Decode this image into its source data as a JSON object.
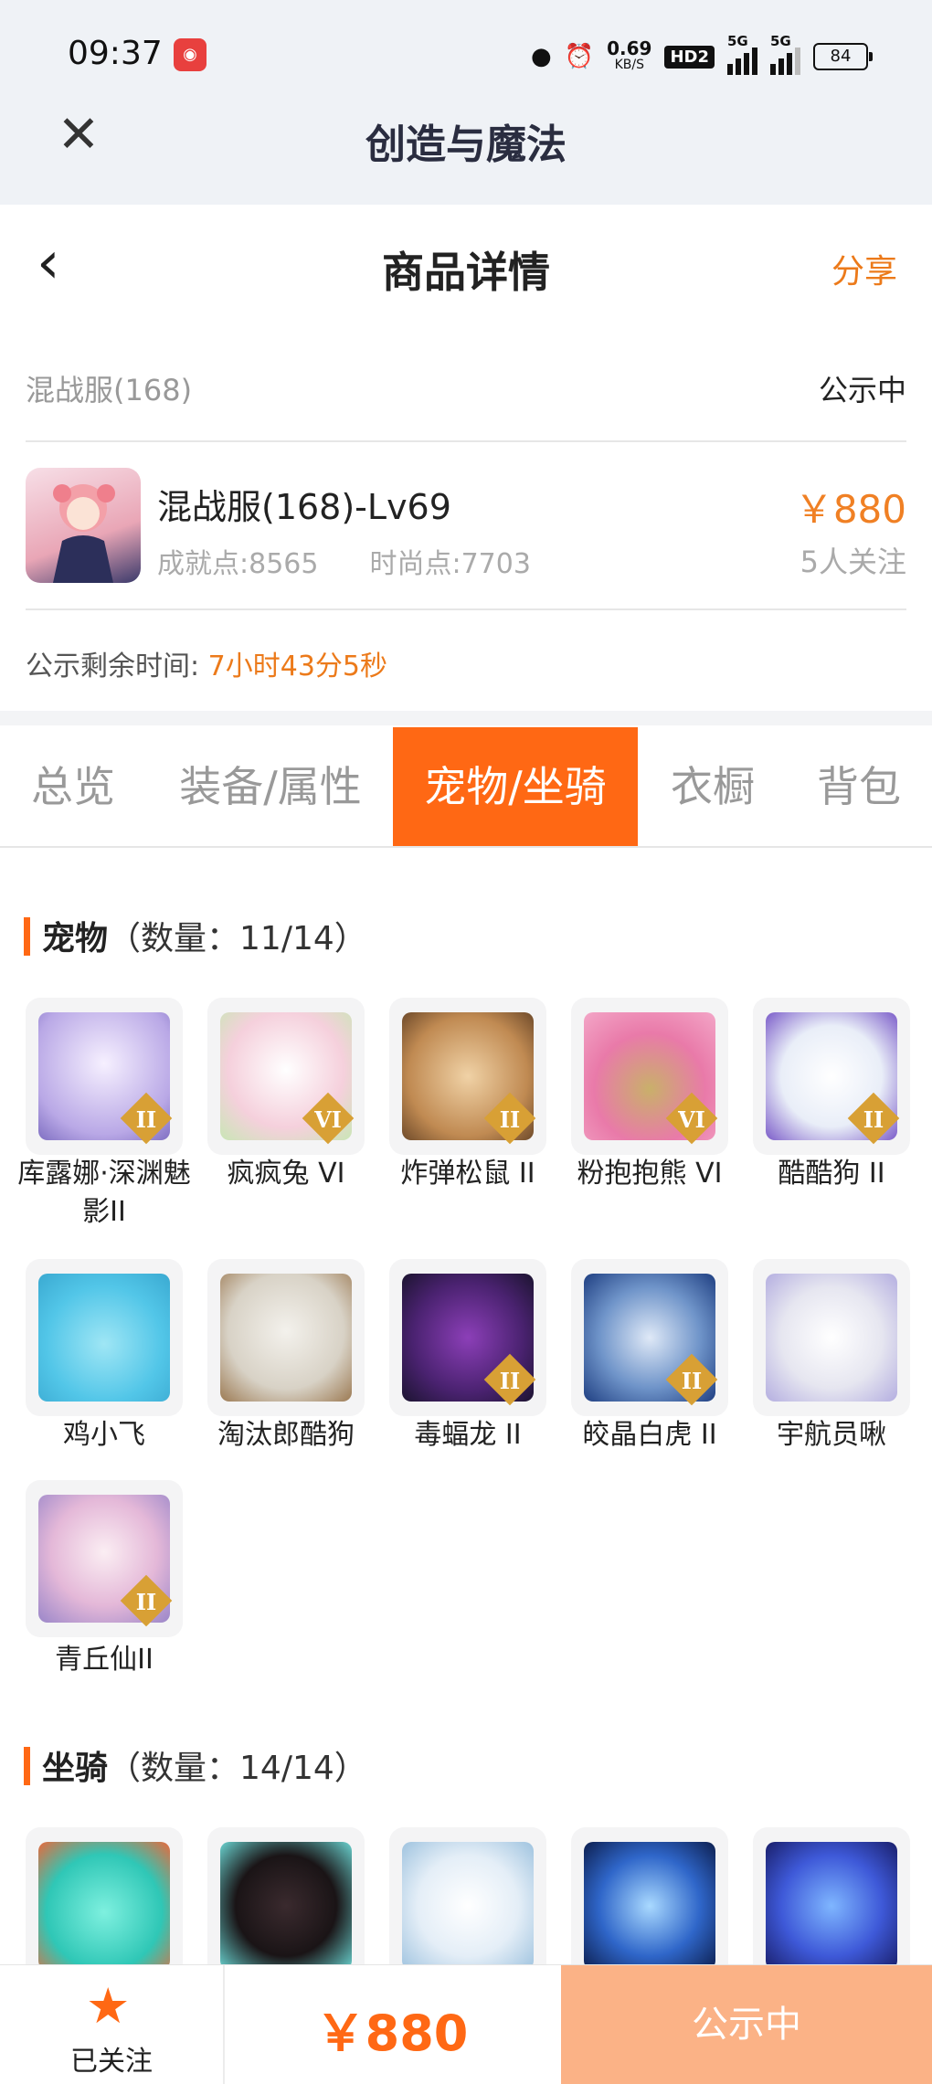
{
  "status_bar": {
    "time": "09:37",
    "speed_value": "0.69",
    "speed_unit": "KB/S",
    "hd": "HD2",
    "net1": "5G",
    "net2": "5G",
    "battery": "84"
  },
  "app_bar": {
    "close_icon": "✕",
    "title": "创造与魔法"
  },
  "header": {
    "back_icon": "‹",
    "title": "商品详情",
    "share": "分享"
  },
  "server": {
    "name": "混战服(168)",
    "status": "公示中"
  },
  "role": {
    "name": "混战服(168)-Lv69",
    "achievement": "成就点:8565",
    "fashion": "时尚点:7703",
    "price": "￥880",
    "followers": "5人关注"
  },
  "countdown": {
    "label": "公示剩余时间:",
    "value": "7小时43分5秒"
  },
  "tabs": [
    {
      "label": "总览",
      "active": false
    },
    {
      "label": "装备/属性",
      "active": false
    },
    {
      "label": "宠物/坐骑",
      "active": true
    },
    {
      "label": "衣橱",
      "active": false
    },
    {
      "label": "背包",
      "active": false
    }
  ],
  "pets": {
    "title": "宠物",
    "count": "（数量：11/14）",
    "items": [
      {
        "name": "库露娜·深渊魅影II",
        "badge": "II"
      },
      {
        "name": "疯疯兔 VI",
        "badge": "VI"
      },
      {
        "name": "炸弹松鼠 II",
        "badge": "II"
      },
      {
        "name": "粉抱抱熊 VI",
        "badge": "VI"
      },
      {
        "name": "酷酷狗 II",
        "badge": "II"
      },
      {
        "name": "鸡小飞",
        "badge": ""
      },
      {
        "name": "淘汰郎酷狗",
        "badge": ""
      },
      {
        "name": "毒蝠龙 II",
        "badge": "II"
      },
      {
        "name": "皎晶白虎 II",
        "badge": "II"
      },
      {
        "name": "宇航员啾",
        "badge": ""
      },
      {
        "name": "青丘仙II",
        "badge": "II"
      }
    ]
  },
  "mounts": {
    "title": "坐骑",
    "count": "（数量：14/14）"
  },
  "bottom": {
    "star_icon": "★",
    "follow_label": "已关注",
    "price": "￥880",
    "status_button": "公示中"
  }
}
